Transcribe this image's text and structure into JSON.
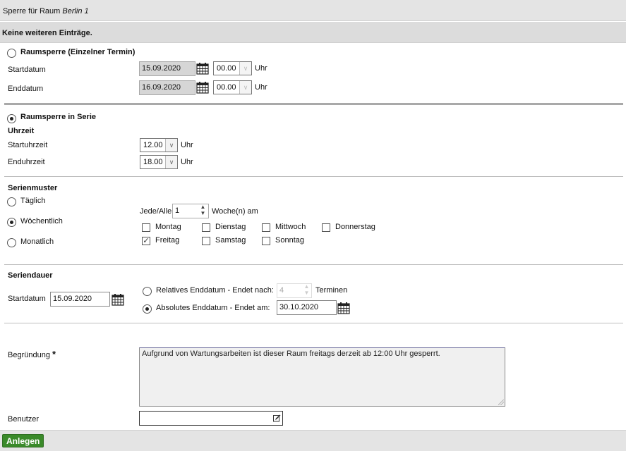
{
  "header": {
    "title_prefix": "Sperre für Raum",
    "title_room": "Berlin 1"
  },
  "info": {
    "message": "Keine weiteren Einträge."
  },
  "single": {
    "radio_label": "Raumsperre (Einzelner Termin)",
    "start_label": "Startdatum",
    "start_date": "15.09.2020",
    "start_time": "00.00",
    "end_label": "Enddatum",
    "end_date": "16.09.2020",
    "end_time": "00.00",
    "unit": "Uhr"
  },
  "series": {
    "radio_label": "Raumsperre in Serie",
    "time_heading": "Uhrzeit",
    "start_time_label": "Startuhrzeit",
    "start_time": "12.00",
    "end_time_label": "Enduhrzeit",
    "end_time": "18.00",
    "unit": "Uhr"
  },
  "pattern": {
    "heading": "Serienmuster",
    "options": [
      "Täglich",
      "Wöchentlich",
      "Monatlich"
    ],
    "every_label": "Jede/Alle",
    "every_value": "1",
    "every_unit": "Woche(n) am",
    "days": [
      {
        "label": "Montag",
        "checked": false
      },
      {
        "label": "Dienstag",
        "checked": false
      },
      {
        "label": "Mittwoch",
        "checked": false
      },
      {
        "label": "Donnerstag",
        "checked": false
      },
      {
        "label": "Freitag",
        "checked": true
      },
      {
        "label": "Samstag",
        "checked": false
      },
      {
        "label": "Sonntag",
        "checked": false
      }
    ]
  },
  "duration": {
    "heading": "Seriendauer",
    "start_label": "Startdatum",
    "start_date": "15.09.2020",
    "relative_label": "Relatives Enddatum - Endet nach:",
    "relative_value": "4",
    "relative_unit": "Terminen",
    "absolute_label": "Absolutes Enddatum - Endet am:",
    "absolute_date": "30.10.2020"
  },
  "reason": {
    "label": "Begründung",
    "required_mark": "*",
    "text": "Aufgrund von Wartungsarbeiten ist dieser Raum freitags derzeit ab 12:00 Uhr gesperrt."
  },
  "user": {
    "label": "Benutzer",
    "value": ""
  },
  "footer": {
    "submit_label": "Anlegen"
  },
  "icons": {
    "calendar": "calendar-icon",
    "edit": "edit-icon"
  },
  "colors": {
    "accent": "#3a8a2a"
  }
}
